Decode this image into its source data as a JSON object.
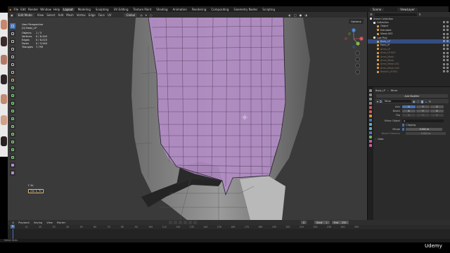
{
  "topbar": {
    "menus": [
      "File",
      "Edit",
      "Render",
      "Window",
      "Help"
    ],
    "workspaces": [
      "Layout",
      "Modeling",
      "Sculpting",
      "UV Editing",
      "Texture Paint",
      "Shading",
      "Animation",
      "Rendering",
      "Compositing",
      "Geometry Nodes",
      "Scripting"
    ],
    "active_workspace": "Layout",
    "scene_label": "Scene",
    "view_layer_label": "ViewLayer"
  },
  "viewport_header": {
    "mode": "Edit Mode",
    "menus": [
      "View",
      "Select",
      "Add",
      "Mesh",
      "Vertex",
      "Edge",
      "Face",
      "UV"
    ],
    "transform_orientation": "Global",
    "options_label": "Options"
  },
  "viewport_info": {
    "view_name": "User Perspective",
    "object_name": "(0) Body_LP",
    "stats": [
      {
        "label": "Objects",
        "value": "1 / 3"
      },
      {
        "label": "Vertices",
        "value": "0 / 8,543"
      },
      {
        "label": "Edges",
        "value": "0 / 8,023"
      },
      {
        "label": "Faces",
        "value": "0 / 3,943"
      },
      {
        "label": "Triangles",
        "value": "7,799"
      }
    ]
  },
  "key_hint": {
    "keys": "F 4k",
    "combo": "Ctrl X, RI"
  },
  "outliner": {
    "rows": [
      {
        "label": "Scene Collection",
        "icon": "collection-icon",
        "level": 0
      },
      {
        "label": "Collection",
        "icon": "collection-icon",
        "level": 1
      },
      {
        "label": "Object",
        "icon": "mesh-icon",
        "level": 2
      },
      {
        "label": "Extruded",
        "icon": "mesh-icon",
        "level": 2
      },
      {
        "label": "Views.003",
        "icon": "mesh-icon",
        "level": 2
      },
      {
        "label": "Low Poly",
        "icon": "collection-icon",
        "level": 1
      },
      {
        "label": "Body_LP",
        "icon": "mesh-icon",
        "level": 2,
        "selected": true
      },
      {
        "label": "Face_LP",
        "icon": "mesh-icon",
        "level": 2
      },
      {
        "label": "Arms_LP",
        "icon": "mesh-icon",
        "level": 2,
        "dim": true
      },
      {
        "label": "Arms_LP.003",
        "icon": "mesh-icon",
        "level": 2,
        "dim": true
      },
      {
        "label": "Arms_Mesh",
        "icon": "mesh-icon",
        "level": 2,
        "dim": true
      },
      {
        "label": "Arms_Mesh",
        "icon": "mesh-icon",
        "level": 2,
        "dim": true
      },
      {
        "label": "Arms_Mesh.001",
        "icon": "mesh-icon",
        "level": 2,
        "dim": true
      },
      {
        "label": "Arms_Mesh.002",
        "icon": "mesh-icon",
        "level": 2,
        "dim": true
      },
      {
        "label": "BodyIn_LP.001",
        "icon": "mesh-icon",
        "level": 2,
        "dim": true
      }
    ]
  },
  "properties": {
    "object_name": "Body_LP",
    "tab_label": "Mirror",
    "add_modifier_label": "Add Modifier",
    "modifier_name": "Mirror",
    "axis_label": "Axis",
    "bisect_label": "Bisect",
    "flip_label": "Flip",
    "axes": [
      "X",
      "Y",
      "Z"
    ],
    "mirror_object_label": "Mirror Object",
    "clipping_label": "Clipping",
    "merge_label": "Merge",
    "merge_value": "0.002 m",
    "bisect_distance_label": "Bisect Distance",
    "bisect_distance_value": "0.001 m",
    "data_label": "Data"
  },
  "timeline": {
    "menus": [
      "Playback",
      "Keying",
      "View",
      "Marker"
    ],
    "current_frame": "0",
    "start_label": "Start",
    "start_value": "1",
    "end_label": "End",
    "end_value": "250",
    "ticks": [
      "0",
      "10",
      "20",
      "30",
      "40",
      "50",
      "60",
      "70",
      "80",
      "90",
      "100",
      "110",
      "120",
      "130",
      "140",
      "150",
      "160",
      "170",
      "180",
      "190",
      "200",
      "210",
      "220",
      "230",
      "240",
      "250"
    ]
  },
  "statusbar": {
    "text": "Select Verts"
  },
  "watermark": "Udemy",
  "colors": {
    "accent": "#4772b3",
    "mesh_face": "#b08cc4",
    "background": "#3a3a3a"
  }
}
